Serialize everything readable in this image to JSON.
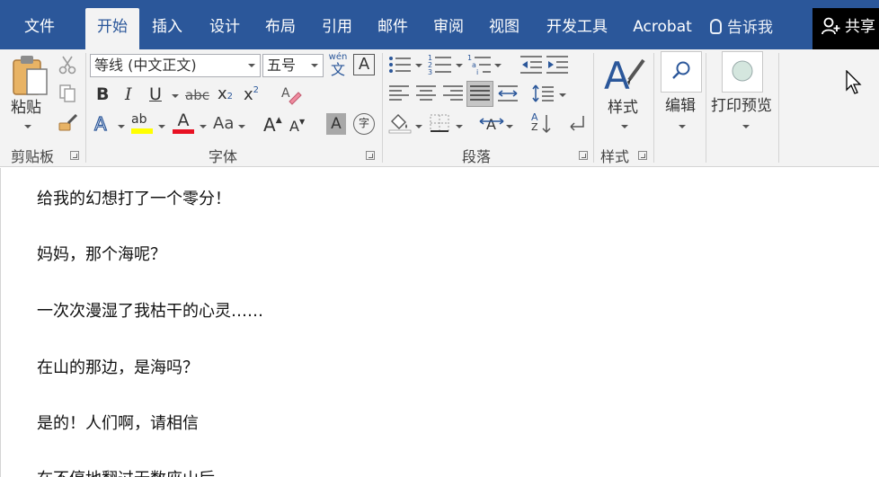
{
  "tabs": [
    {
      "label": "文件"
    },
    {
      "label": "开始"
    },
    {
      "label": "插入"
    },
    {
      "label": "设计"
    },
    {
      "label": "布局"
    },
    {
      "label": "引用"
    },
    {
      "label": "邮件"
    },
    {
      "label": "审阅"
    },
    {
      "label": "视图"
    },
    {
      "label": "开发工具"
    },
    {
      "label": "Acrobat"
    }
  ],
  "tell_me": "告诉我",
  "share": "共享",
  "clipboard": {
    "paste_label": "粘贴",
    "group_label": "剪贴板"
  },
  "font": {
    "name": "等线 (中文正文)",
    "size": "五号",
    "phonetic_small": "wén",
    "phonetic_big": "文",
    "border_char": "A",
    "bold": "B",
    "italic": "I",
    "underline": "U",
    "strike": "abc",
    "sub": "x",
    "sub_mark": "2",
    "sup": "x",
    "sup_mark": "2",
    "effects": "A",
    "highlight": "ab",
    "color": "A",
    "change_case": "Aa",
    "grow": "A",
    "shrink": "A",
    "shading": "A",
    "enclose": "字",
    "group_label": "字体"
  },
  "paragraph": {
    "group_label": "段落",
    "sort_a": "A",
    "sort_z": "Z"
  },
  "styles": {
    "label": "样式",
    "group_label": "样式"
  },
  "editing": {
    "label": "编辑"
  },
  "print_preview": {
    "label": "打印预览"
  },
  "colors": {
    "brand": "#2b579a",
    "highlight": "#ffff00",
    "font_color": "#e81123"
  },
  "document": {
    "paragraphs": [
      "给我的幻想打了一个零分！",
      "妈妈，那个海呢？",
      "一次次漫湿了我枯干的心灵……",
      "在山的那边，是海吗？",
      "是的！人们啊，请相信",
      "在不停地翻过无数座山后"
    ]
  }
}
